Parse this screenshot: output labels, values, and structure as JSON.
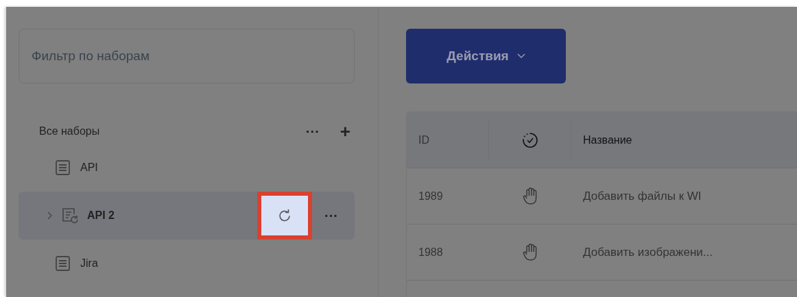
{
  "sidebar": {
    "filter": {
      "placeholder": "Фильтр по наборам"
    },
    "header": {
      "label": "Все наборы",
      "more": "···",
      "add": "+"
    },
    "items": [
      {
        "label": "API",
        "kind": "plain",
        "selected": false,
        "expandable": false
      },
      {
        "label": "API 2",
        "kind": "synced",
        "selected": true,
        "expandable": true,
        "refresh_highlighted": true,
        "more": "···"
      },
      {
        "label": "Jira",
        "kind": "plain",
        "selected": false,
        "expandable": false
      }
    ]
  },
  "main": {
    "actions_button": "Действия",
    "table": {
      "columns": [
        {
          "label": "ID",
          "kind": "text"
        },
        {
          "kind": "status-icon"
        },
        {
          "label": "Название",
          "kind": "text"
        }
      ],
      "rows": [
        {
          "id": "1989",
          "kind": "manual",
          "title": "Добавить файлы к WI"
        },
        {
          "id": "1988",
          "kind": "manual",
          "title": "Добавить изображени..."
        }
      ]
    }
  }
}
